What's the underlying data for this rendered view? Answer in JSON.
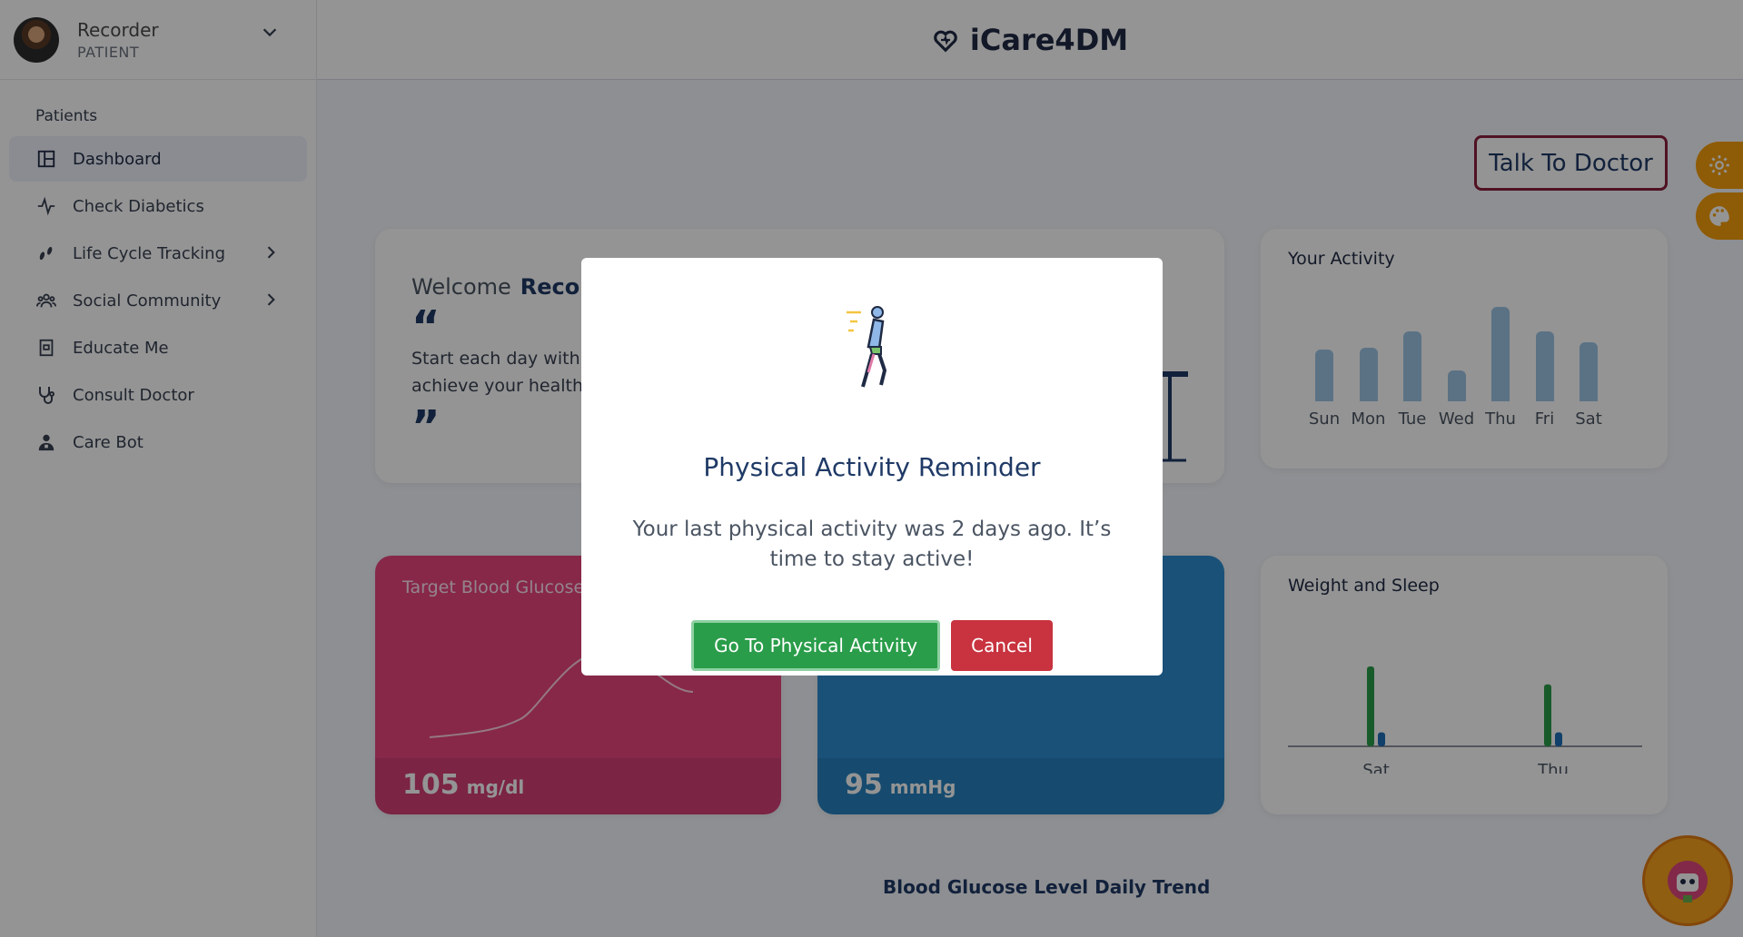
{
  "user": {
    "name": "Recorder",
    "role": "PATIENT"
  },
  "sidebar": {
    "section_title": "Patients",
    "items": [
      {
        "label": "Dashboard"
      },
      {
        "label": "Check Diabetics"
      },
      {
        "label": "Life Cycle Tracking"
      },
      {
        "label": "Social Community"
      },
      {
        "label": "Educate Me"
      },
      {
        "label": "Consult Doctor"
      },
      {
        "label": "Care Bot"
      }
    ]
  },
  "header": {
    "brand": "iCare4DM"
  },
  "talk_button": "Talk To Doctor",
  "welcome": {
    "greeting": "Welcome",
    "name": "Recorder",
    "open_quote": "“",
    "close_quote": "”",
    "quote_line1": "Start each day with a",
    "quote_line2": "achieve your health g"
  },
  "activity": {
    "title": "Your Activity"
  },
  "glucose": {
    "title": "Target Blood Glucose",
    "value": "105",
    "unit": "mg/dl"
  },
  "bp": {
    "value": "95",
    "unit": "mmHg"
  },
  "weight_sleep": {
    "title": "Weight and Sleep"
  },
  "trend_title": "Blood Glucose Level Daily Trend",
  "modal": {
    "title": "Physical Activity Reminder",
    "message": "Your last physical activity was 2 days ago. It’s time to stay active!",
    "go_label": "Go To Physical Activity",
    "cancel_label": "Cancel"
  },
  "colors": {
    "accent": "#1f3a66",
    "go": "#2a9d4a",
    "cancel": "#c8333f",
    "glucose": "#e8457f",
    "bp": "#2b8cd0",
    "fab": "#f59e0b"
  },
  "chart_data": [
    {
      "type": "bar",
      "title": "Your Activity",
      "categories": [
        "Sun",
        "Mon",
        "Tue",
        "Wed",
        "Thu",
        "Fri",
        "Sat"
      ],
      "values": [
        57,
        59,
        77,
        34,
        104,
        77,
        65
      ],
      "ylim": [
        0,
        110
      ]
    },
    {
      "type": "bar",
      "title": "Weight and Sleep",
      "categories": [
        "Sat",
        "Thu"
      ],
      "series": [
        {
          "values": [
            80,
            62
          ],
          "color": "#2a9d4a"
        },
        {
          "values": [
            14,
            14
          ],
          "color": "#1e6fb8"
        }
      ],
      "ylim": [
        0,
        100
      ]
    }
  ]
}
